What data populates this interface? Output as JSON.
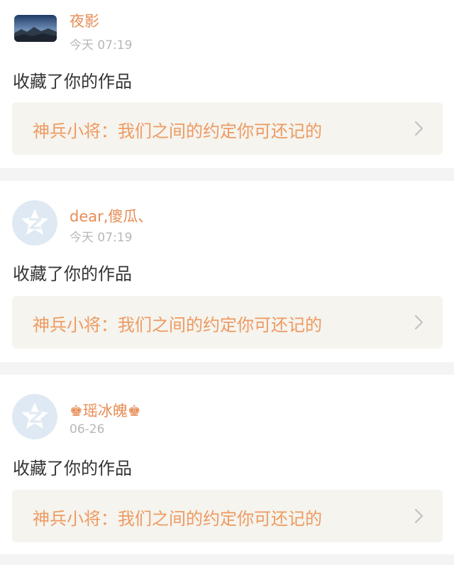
{
  "colors": {
    "accent": "#e78c55",
    "link_text": "#ee9a62",
    "link_bg": "#f5f4ee",
    "timestamp": "#b7b7b7",
    "body_text": "#333333",
    "separator": "#f4f4f4"
  },
  "notifications": [
    {
      "avatar_icon": "landscape-photo-avatar",
      "user_name": "夜影",
      "time": "今天 07:19",
      "action": "收藏了你的作品",
      "work_title": "神兵小将：我们之间的约定你可还记的",
      "link_icon": "chevron-right-icon"
    },
    {
      "avatar_icon": "qzone-default-avatar",
      "user_name": "dear,傻瓜、",
      "time": "今天 07:19",
      "action": "收藏了你的作品",
      "work_title": "神兵小将：我们之间的约定你可还记的",
      "link_icon": "chevron-right-icon"
    },
    {
      "avatar_icon": "qzone-default-avatar",
      "user_name": "♚瑶冰魄♚",
      "time": "06-26",
      "action": "收藏了你的作品",
      "work_title": "神兵小将：我们之间的约定你可还记的",
      "link_icon": "chevron-right-icon"
    }
  ]
}
